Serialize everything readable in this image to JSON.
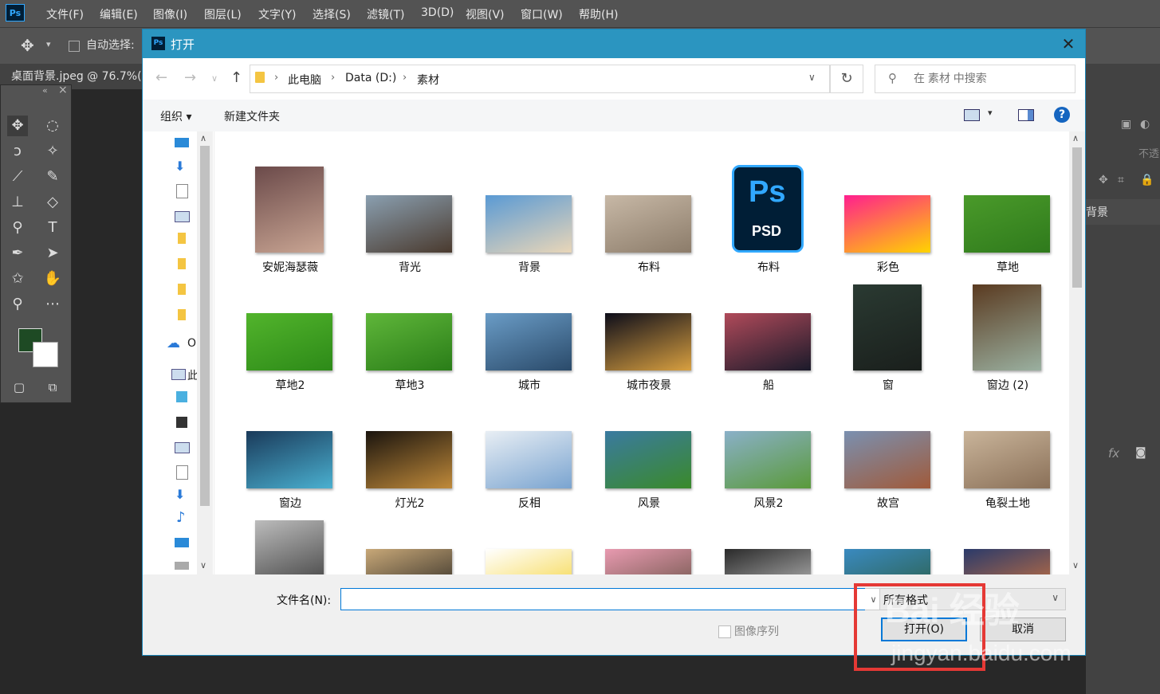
{
  "app": {
    "logo": "Ps",
    "menus": [
      "文件(F)",
      "编辑(E)",
      "图像(I)",
      "图层(L)",
      "文字(Y)",
      "选择(S)",
      "滤镜(T)",
      "3D(D)",
      "视图(V)",
      "窗口(W)",
      "帮助(H)"
    ],
    "options": {
      "auto_select": "自动选择:"
    },
    "doc_tab": "桌面背景.jpeg @ 76.7%(",
    "right_panel": {
      "opacity_label": "不透",
      "layer_name": "背景",
      "fx": "fx"
    }
  },
  "dialog": {
    "title": "打开",
    "icon_text": "Ps",
    "breadcrumb": [
      "此电脑",
      "Data (D:)",
      "素材"
    ],
    "search_placeholder": "在 素材 中搜索",
    "commands": {
      "organize": "组织 ▾",
      "new_folder": "新建文件夹",
      "help": "?"
    },
    "sidebar_labels": {
      "onedrive": "O",
      "this_pc": "此"
    },
    "files": [
      {
        "name": "安妮海瑟薇",
        "kind": "portrait",
        "colors": [
          "#6b4a4a",
          "#c9a593"
        ]
      },
      {
        "name": "背光",
        "kind": "photo",
        "colors": [
          "#8a9fb0",
          "#4a3a2e"
        ]
      },
      {
        "name": "背景",
        "kind": "photo",
        "colors": [
          "#5a9ad4",
          "#e9d6b8"
        ]
      },
      {
        "name": "布料",
        "kind": "photo",
        "colors": [
          "#c7b8a6",
          "#8c7c6a"
        ]
      },
      {
        "name": "布料",
        "kind": "psd",
        "colors": [
          "#001e36",
          "#31a8ff"
        ]
      },
      {
        "name": "彩色",
        "kind": "photo",
        "colors": [
          "#ff1f8e",
          "#ffd400"
        ]
      },
      {
        "name": "草地",
        "kind": "photo",
        "colors": [
          "#4a9a2a",
          "#2f7a1c"
        ]
      },
      {
        "name": "草地2",
        "kind": "photo",
        "colors": [
          "#52b42c",
          "#2d8a18"
        ]
      },
      {
        "name": "草地3",
        "kind": "photo",
        "colors": [
          "#5fb63a",
          "#2a7d18"
        ]
      },
      {
        "name": "城市",
        "kind": "photo",
        "colors": [
          "#6a9cc6",
          "#2a4a6a"
        ]
      },
      {
        "name": "城市夜景",
        "kind": "photo",
        "colors": [
          "#0d0d1a",
          "#d9a040"
        ]
      },
      {
        "name": "船",
        "kind": "photo",
        "colors": [
          "#b04a5a",
          "#1a1a2a"
        ]
      },
      {
        "name": "窗",
        "kind": "portrait",
        "colors": [
          "#2a3a32",
          "#1a1f1c"
        ]
      },
      {
        "name": "窗边 (2)",
        "kind": "portrait",
        "colors": [
          "#5a3a20",
          "#9ab0a0"
        ]
      },
      {
        "name": "窗边",
        "kind": "photo",
        "colors": [
          "#1a3a5a",
          "#4ab0d0"
        ]
      },
      {
        "name": "灯光2",
        "kind": "photo",
        "colors": [
          "#1a140e",
          "#c08a3a"
        ]
      },
      {
        "name": "反相",
        "kind": "photo",
        "colors": [
          "#e8eef4",
          "#7aa4d0"
        ]
      },
      {
        "name": "风景",
        "kind": "photo",
        "colors": [
          "#3a7aa0",
          "#3a8a2a"
        ]
      },
      {
        "name": "风景2",
        "kind": "photo",
        "colors": [
          "#8ab0c8",
          "#5a9a3a"
        ]
      },
      {
        "name": "故宫",
        "kind": "photo",
        "colors": [
          "#7a90b0",
          "#a05a3a"
        ]
      },
      {
        "name": "龟裂土地",
        "kind": "photo",
        "colors": [
          "#c9b49a",
          "#8a7058"
        ]
      },
      {
        "name": "",
        "kind": "portrait",
        "colors": [
          "#bcbcbc",
          "#2a2a2a"
        ]
      },
      {
        "name": "",
        "kind": "photo",
        "colors": [
          "#c8a878",
          "#1a1a1a"
        ]
      },
      {
        "name": "",
        "kind": "photo",
        "colors": [
          "#ffffff",
          "#f4d02a"
        ]
      },
      {
        "name": "",
        "kind": "photo",
        "colors": [
          "#e89ab0",
          "#5a4a3a"
        ]
      },
      {
        "name": "",
        "kind": "photo",
        "colors": [
          "#2a2a2a",
          "#d0d0d0"
        ]
      },
      {
        "name": "",
        "kind": "photo",
        "colors": [
          "#3a8ac0",
          "#2a5a3a"
        ]
      },
      {
        "name": "",
        "kind": "photo",
        "colors": [
          "#2a3a6a",
          "#e07a3a"
        ]
      }
    ],
    "filename_label": "文件名(N):",
    "filename_value": "",
    "format": "所有格式",
    "image_sequence": "图像序列",
    "open_button": "打开(O)",
    "cancel_button": "取消"
  },
  "watermark": {
    "main": "Bai 经验",
    "sub": "jingyan.baidu.com"
  }
}
